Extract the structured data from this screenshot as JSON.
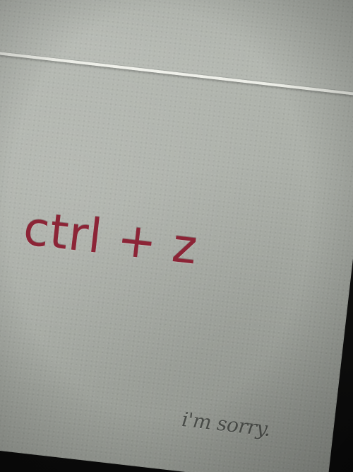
{
  "card": {
    "main_text": "ctrl + z",
    "sub_text": "i'm sorry."
  },
  "colors": {
    "ink_red": "#8c2436",
    "ink_gray": "#4a4d49",
    "paper": "#a8aca5"
  }
}
